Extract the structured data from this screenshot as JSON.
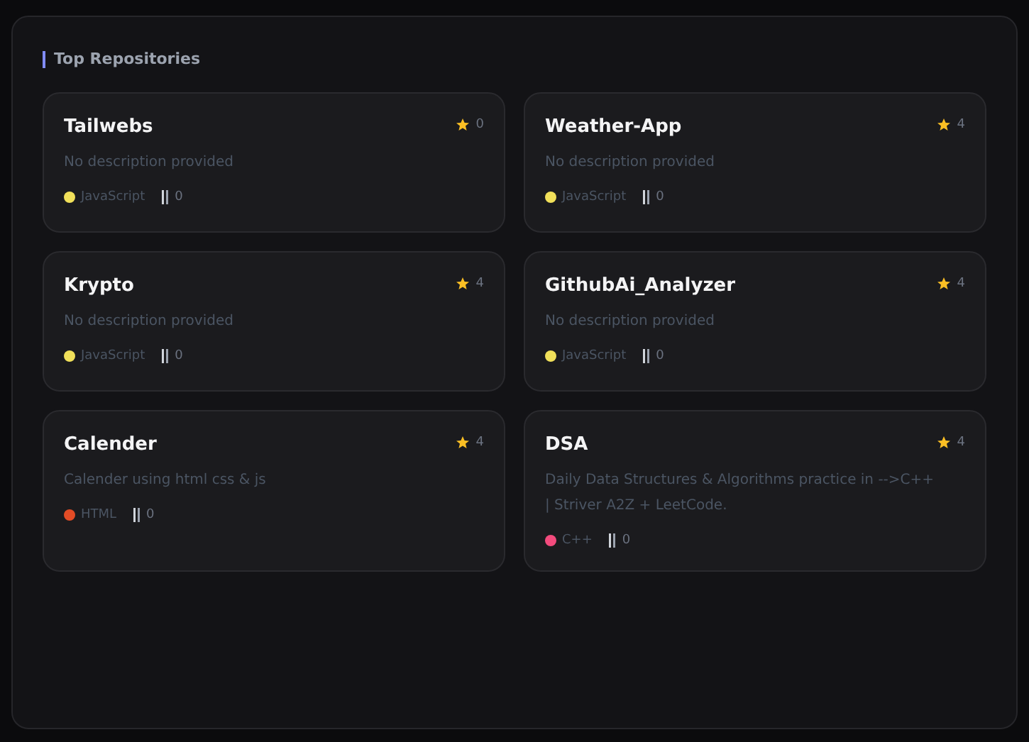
{
  "section_title": "Top Repositories",
  "repositories": [
    {
      "name": "Tailwebs",
      "stars": "0",
      "description": "No description provided",
      "language": "JavaScript",
      "color": "#f1e05a",
      "forks": "0"
    },
    {
      "name": "Weather-App",
      "stars": "4",
      "description": "No description provided",
      "language": "JavaScript",
      "color": "#f1e05a",
      "forks": "0"
    },
    {
      "name": "Krypto",
      "stars": "4",
      "description": "No description provided",
      "language": "JavaScript",
      "color": "#f1e05a",
      "forks": "0"
    },
    {
      "name": "GithubAi_Analyzer",
      "stars": "4",
      "description": "No description provided",
      "language": "JavaScript",
      "color": "#f1e05a",
      "forks": "0"
    },
    {
      "name": "Calender",
      "stars": "4",
      "description": "Calender using html css & js",
      "language": "HTML",
      "color": "#e34c26",
      "forks": "0"
    },
    {
      "name": "DSA",
      "stars": "4",
      "description": "Daily Data Structures & Algorithms practice in -->C++ | Striver A2Z + LeetCode.",
      "language": "C++",
      "color": "#f34b7d",
      "forks": "0"
    }
  ]
}
